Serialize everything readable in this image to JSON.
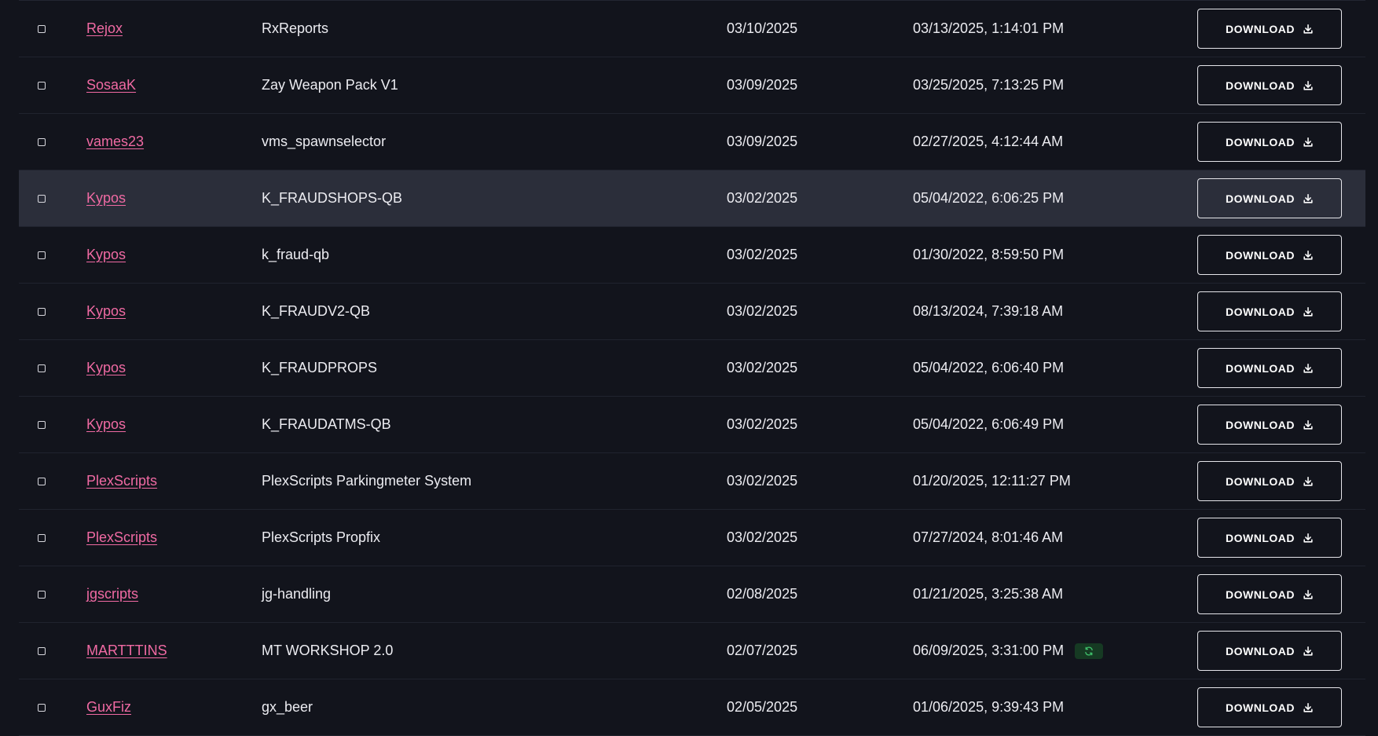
{
  "table": {
    "download_label": "DOWNLOAD",
    "rows": [
      {
        "author": "Rejox",
        "name": "RxReports",
        "date": "03/10/2025",
        "updated": "03/13/2025, 1:14:01 PM"
      },
      {
        "author": "SosaaK",
        "name": "Zay Weapon Pack V1",
        "date": "03/09/2025",
        "updated": "03/25/2025, 7:13:25 PM"
      },
      {
        "author": "vames23",
        "name": "vms_spawnselector",
        "date": "03/09/2025",
        "updated": "02/27/2025, 4:12:44 AM"
      },
      {
        "author": "Kypos",
        "name": "K_FRAUDSHOPS-QB",
        "date": "03/02/2025",
        "updated": "05/04/2022, 6:06:25 PM",
        "highlighted": true
      },
      {
        "author": "Kypos",
        "name": "k_fraud-qb",
        "date": "03/02/2025",
        "updated": "01/30/2022, 8:59:50 PM"
      },
      {
        "author": "Kypos",
        "name": "K_FRAUDV2-QB",
        "date": "03/02/2025",
        "updated": "08/13/2024, 7:39:18 AM"
      },
      {
        "author": "Kypos",
        "name": "K_FRAUDPROPS",
        "date": "03/02/2025",
        "updated": "05/04/2022, 6:06:40 PM"
      },
      {
        "author": "Kypos",
        "name": "K_FRAUDATMS-QB",
        "date": "03/02/2025",
        "updated": "05/04/2022, 6:06:49 PM"
      },
      {
        "author": "PlexScripts",
        "name": "PlexScripts Parkingmeter System",
        "date": "03/02/2025",
        "updated": "01/20/2025, 12:11:27 PM"
      },
      {
        "author": "PlexScripts",
        "name": "PlexScripts Propfix",
        "date": "03/02/2025",
        "updated": "07/27/2024, 8:01:46 AM"
      },
      {
        "author": "jgscripts",
        "name": "jg-handling",
        "date": "02/08/2025",
        "updated": "01/21/2025, 3:25:38 AM"
      },
      {
        "author": "MARTTTINS",
        "name": "MT WORKSHOP 2.0",
        "date": "02/07/2025",
        "updated": "06/09/2025, 3:31:00 PM",
        "sync_icon": "refresh-icon"
      },
      {
        "author": "GuxFiz",
        "name": "gx_beer",
        "date": "02/05/2025",
        "updated": "01/06/2025, 9:39:43 PM"
      }
    ]
  },
  "colors": {
    "background": "#12141c",
    "highlight_row": "#2b2e3a",
    "author_link": "#f06aa3",
    "sync_badge_bg": "#163a23",
    "sync_icon": "#3fbf6a"
  }
}
